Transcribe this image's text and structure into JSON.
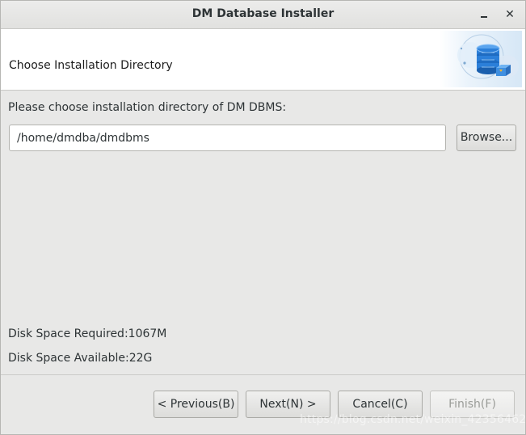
{
  "window": {
    "title": "DM Database Installer"
  },
  "titlebar": {
    "minimize_icon": "minimize-icon",
    "close_icon": "close-icon",
    "close_label": "✕"
  },
  "header": {
    "title": "Choose Installation Directory",
    "logo_icon": "database-stack-icon"
  },
  "main": {
    "prompt": "Please choose installation directory of DM DBMS:",
    "install_path_value": "/home/dmdba/dmdbms",
    "browse_label": "Browse...",
    "disk_space_required": "Disk Space Required:1067M",
    "disk_space_available": "Disk Space Available:22G"
  },
  "footer": {
    "previous_label": "< Previous(B)",
    "next_label": "Next(N) >",
    "cancel_label": "Cancel(C)",
    "finish_label": "Finish(F)",
    "finish_enabled": false
  },
  "watermark": {
    "text": "https://blog.csdn.net/weixin_42356462"
  },
  "colors": {
    "window_bg": "#e8e8e7",
    "header_bg": "#ffffff",
    "db_icon_blue": "#2b7fd9",
    "desktop_bg": "#3d6b85"
  }
}
